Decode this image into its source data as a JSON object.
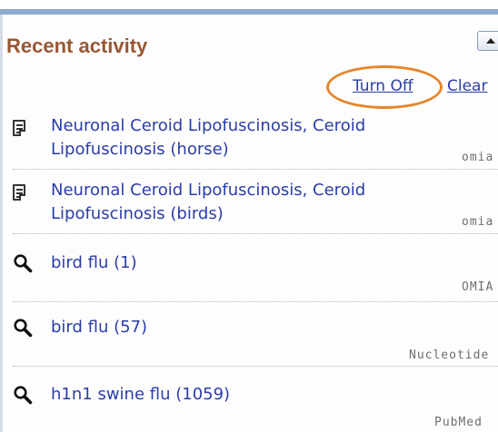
{
  "widget": {
    "title": "Recent activity",
    "toggle_icon": "collapse-up-triangle-icon"
  },
  "actions": {
    "turn_off_label": "Turn Off",
    "clear_label": "Clear",
    "highlight_color": "#e5862d"
  },
  "items": [
    {
      "icon": "document-icon",
      "lines": [
        "Neuronal Ceroid Lipofuscinosis, Ceroid",
        "Lipofuscinosis (horse)"
      ],
      "database": "omia"
    },
    {
      "icon": "document-icon",
      "lines": [
        "Neuronal Ceroid Lipofuscinosis, Ceroid",
        "Lipofuscinosis (birds)"
      ],
      "database": "omia"
    },
    {
      "icon": "search-icon",
      "lines": [
        "bird flu (1)"
      ],
      "database": "OMIA"
    },
    {
      "icon": "search-icon",
      "lines": [
        "bird flu (57)"
      ],
      "database": "Nucleotide"
    },
    {
      "icon": "search-icon",
      "lines": [
        "h1n1 swine flu (1059)"
      ],
      "database": "PubMed"
    }
  ],
  "colors": {
    "title": "#985735",
    "link": "#2b3da8",
    "top_bar": "#8fa9cf"
  }
}
